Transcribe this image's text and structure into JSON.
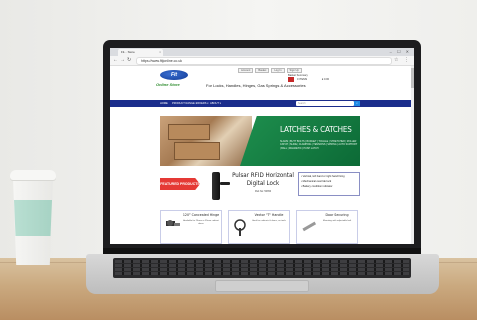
{
  "browser": {
    "tab_label": "Fit... Store",
    "tab_close": "×",
    "window_buttons": "– ☐ ✕",
    "url": "https://www.fitjonline.co.uk"
  },
  "site": {
    "logo_text": "Fit",
    "logo_sub": "Online Store",
    "tagline": "For Locks, Handles, Hinges, Gas Springs & Accessories",
    "top_links": [
      "Account",
      "Basket",
      "Log In",
      "Sign Up"
    ],
    "cart_text": "Basket Summary",
    "cart_items": "0 ITEMS",
    "cart_total": "£ 0.00",
    "nav": [
      "HOME",
      "PRODUCT RANGE ▾",
      "OFFERS ▾",
      "ABOUT ▾"
    ],
    "search_placeholder": "Search",
    "search_icon": "magnifier-icon"
  },
  "banner": {
    "title": "LATCHES & CATCHES",
    "subtitle": "SLAMS | BUTT BOLTS | BUDGET | TOGGLE | STRETCHER | ROLLER CATCH | SLIDE | CLAMPING | TENSIONS | SPRING | AUTO SUPPORT | BALL | MAGNETIC | PUSH LATCH"
  },
  "promo": {
    "featured_label": "FEATURED PRODUCTS",
    "product_title": "Pulsar RFID Horizontal Digital Lock",
    "product_sub": "Part No: 50350",
    "features": [
      "• Vertical, left hand or right hand fixing",
      "• Mechanical override lock",
      "• Battery condition indicator"
    ]
  },
  "cards": [
    {
      "title": "120° Concealed Hinge",
      "text": "Available for 26mm or 35mm cabinet doors"
    },
    {
      "title": "Vector \"T\" Handle",
      "text": "Ideal for cabinets & doors, no tools"
    },
    {
      "title": "Door Securing",
      "text": "Mounting with adjustable bolt"
    }
  ]
}
